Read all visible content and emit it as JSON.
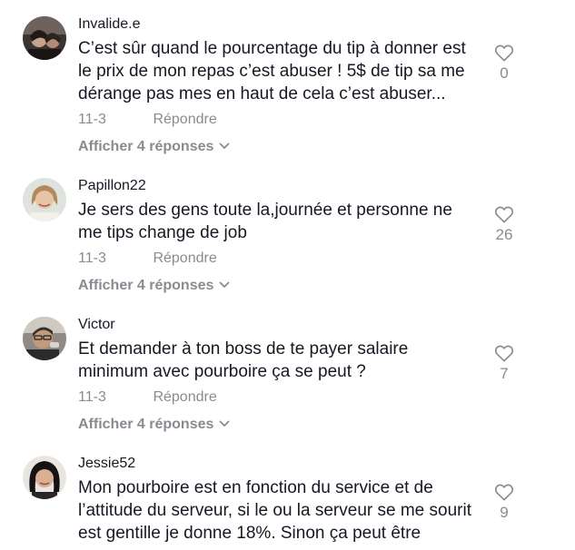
{
  "comments": [
    {
      "username": "Invalide.e",
      "text_lines": [
        "C’est sûr quand le pourcentage du tip à donner est",
        "le prix de mon repas c’est abuser ! 5$ de tip sa me",
        "dérange pas mes en haut de cela c’est abuser..."
      ],
      "date": "11-3",
      "reply_label": "Répondre",
      "view_replies_label": "Afficher 4 réponses",
      "likes": "0"
    },
    {
      "username": "Papillon22",
      "text_lines": [
        "Je sers des gens toute la,journée et personne ne",
        "me tips change de job"
      ],
      "date": "11-3",
      "reply_label": "Répondre",
      "view_replies_label": "Afficher 4 réponses",
      "likes": "26"
    },
    {
      "username": "Victor",
      "text_lines": [
        "Et demander à ton boss de te payer salaire",
        "minimum avec pourboire ça se peut ?"
      ],
      "date": "11-3",
      "reply_label": "Répondre",
      "view_replies_label": "Afficher 4 réponses",
      "likes": "7"
    },
    {
      "username": "Jessie52",
      "text_lines": [
        "Mon pourboire est en fonction du service et de",
        "l’attitude du serveur, si le ou la serveur se me sourit",
        "est gentille je donne 18%. Sinon ça peut être"
      ],
      "likes": "9"
    }
  ],
  "icons": {
    "like": "heart-outline-icon",
    "expand": "chevron-down-icon"
  },
  "colors": {
    "text": "#161823",
    "muted": "#8a8b91",
    "background": "#ffffff"
  }
}
